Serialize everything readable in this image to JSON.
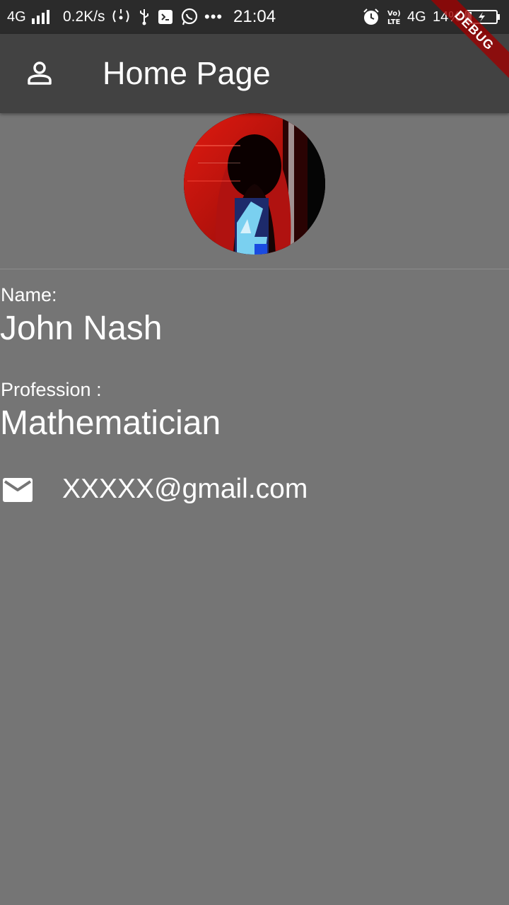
{
  "status_bar": {
    "network_left": "4G",
    "speed": "0.2K/s",
    "time": "21:04",
    "network_right": "4G",
    "volte": "Vo) LTE",
    "battery_percent": "14%",
    "icons": [
      "signal-icon",
      "hotspot-icon",
      "usb-icon",
      "debug-icon",
      "whatsapp-icon",
      "more-icon",
      "alarm-icon",
      "volte-icon",
      "battery-charging-icon"
    ]
  },
  "debug_banner": {
    "label": "DEBUG",
    "color": "#a00000"
  },
  "app_bar": {
    "title": "Home Page",
    "leading_icon": "person-outline-icon",
    "background": "#424242"
  },
  "profile": {
    "avatar_icon": "profile-photo",
    "name_label": "Name:",
    "name": "John Nash",
    "profession_label": "Profession :",
    "profession": "Mathematician",
    "email_icon": "mail-icon",
    "email": "XXXXX@gmail.com"
  },
  "colors": {
    "page_background": "#757575",
    "status_bar_background": "#2b2b2b",
    "text": "#ffffff"
  }
}
